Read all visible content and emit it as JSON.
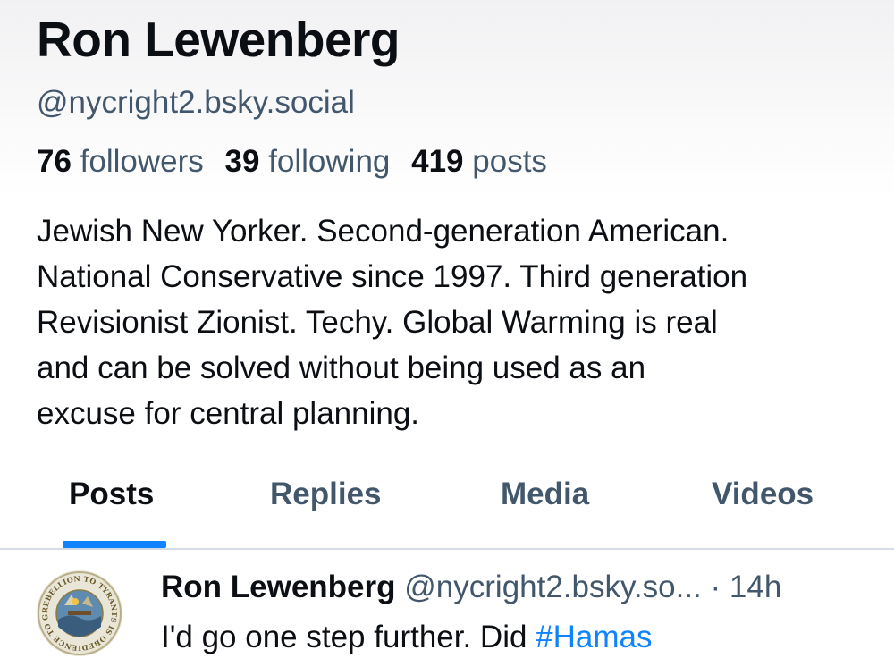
{
  "profile": {
    "display_name": "Ron Lewenberg",
    "handle": "@nycright2.bsky.social",
    "followers_count": "76",
    "followers_label": "followers",
    "following_count": "39",
    "following_label": "following",
    "posts_count": "419",
    "posts_label": "posts",
    "bio": [
      "Jewish New Yorker. Second-generation American.",
      "National Conservative since 1997. Third generation",
      "Revisionist Zionist. Techy. Global Warming is real",
      "and can be solved without being used as an",
      "excuse for central planning."
    ]
  },
  "tabs": [
    {
      "label": "Posts",
      "active": true
    },
    {
      "label": "Replies",
      "active": false
    },
    {
      "label": "Media",
      "active": false
    },
    {
      "label": "Videos",
      "active": false
    }
  ],
  "post": {
    "author": "Ron Lewenberg",
    "handle": "@nycright2.bsky.so...",
    "separator": "·",
    "time": "14h",
    "text_prefix": "I'd go one step further. Did ",
    "hashtag": "#Hamas",
    "avatar_icon": "seal-avatar",
    "avatar_text": "REBELLION TO TYRANTS IS OBEDIENCE TO GOD"
  },
  "colors": {
    "accent": "#1083fe",
    "text_primary": "#0b0f14",
    "text_secondary": "#42576c",
    "divider": "#d4dbe2"
  }
}
